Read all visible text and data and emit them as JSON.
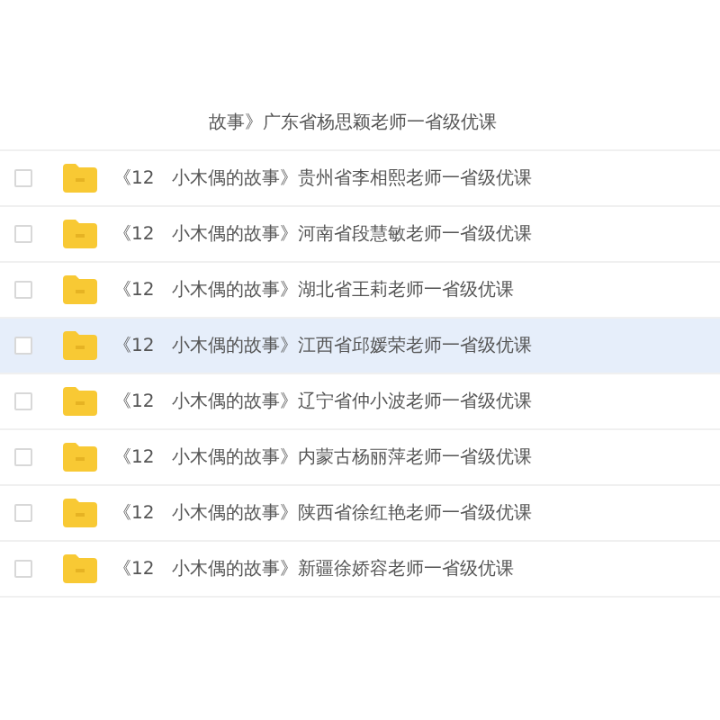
{
  "files": [
    {
      "kind": "clipped",
      "name": "故事》广东省杨思颖老师一省级优课",
      "selected": false
    },
    {
      "kind": "folder",
      "name": "《12　小木偶的故事》贵州省李相熙老师一省级优课",
      "selected": false
    },
    {
      "kind": "folder",
      "name": "《12　小木偶的故事》河南省段慧敏老师一省级优课",
      "selected": false
    },
    {
      "kind": "folder",
      "name": "《12　小木偶的故事》湖北省王莉老师一省级优课",
      "selected": false
    },
    {
      "kind": "folder",
      "name": "《12　小木偶的故事》江西省邱媛荣老师一省级优课",
      "selected": true
    },
    {
      "kind": "folder",
      "name": "《12　小木偶的故事》辽宁省仲小波老师一省级优课",
      "selected": false
    },
    {
      "kind": "folder",
      "name": "《12　小木偶的故事》内蒙古杨丽萍老师一省级优课",
      "selected": false
    },
    {
      "kind": "folder",
      "name": "《12　小木偶的故事》陕西省徐红艳老师一省级优课",
      "selected": false
    },
    {
      "kind": "folder",
      "name": "《12　小木偶的故事》新疆徐娇容老师一省级优课",
      "selected": false
    }
  ]
}
